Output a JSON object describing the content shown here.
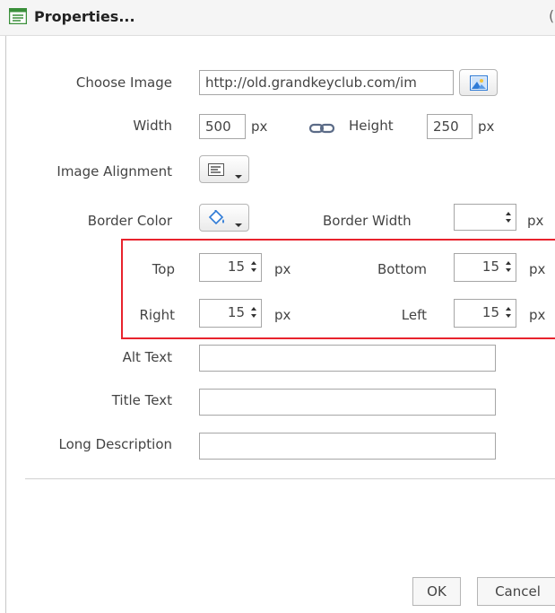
{
  "dialog": {
    "title": "Properties...",
    "title_edge": "("
  },
  "form": {
    "choose_image": {
      "label": "Choose Image",
      "value": "http://old.grandkeyclub.com/im"
    },
    "width": {
      "label": "Width",
      "value": "500",
      "unit": "px"
    },
    "height": {
      "label": "Height",
      "value": "250",
      "unit": "px"
    },
    "image_alignment": {
      "label": "Image Alignment"
    },
    "border_color": {
      "label": "Border Color"
    },
    "border_width": {
      "label": "Border Width",
      "value": "",
      "unit": "px"
    },
    "margins": {
      "top": {
        "label": "Top",
        "value": "15",
        "unit": "px"
      },
      "bottom": {
        "label": "Bottom",
        "value": "15",
        "unit": "px"
      },
      "right": {
        "label": "Right",
        "value": "15",
        "unit": "px"
      },
      "left": {
        "label": "Left",
        "value": "15",
        "unit": "px"
      }
    },
    "alt_text": {
      "label": "Alt Text",
      "value": ""
    },
    "title_text": {
      "label": "Title Text",
      "value": ""
    },
    "long_description": {
      "label": "Long Description",
      "value": ""
    }
  },
  "footer": {
    "ok_label": "OK",
    "cancel_label": "Cancel"
  },
  "colors": {
    "highlight": "#e8232d",
    "icon_blue": "#2f7bd6",
    "icon_green": "#3a8f3a"
  }
}
